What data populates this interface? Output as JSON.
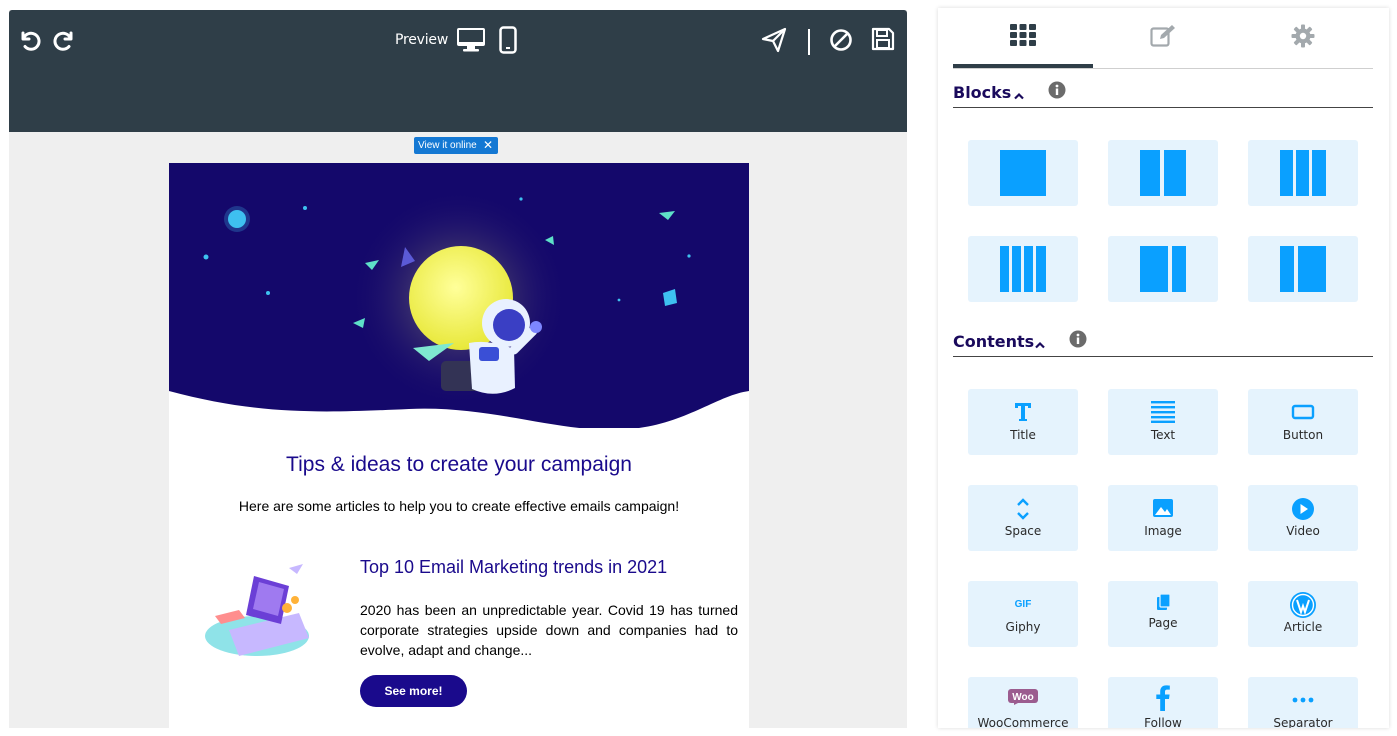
{
  "toolbar": {
    "preview_label": "Preview",
    "icons": [
      "undo-icon",
      "redo-icon",
      "desktop-icon",
      "mobile-icon",
      "send-test-icon",
      "cancel-icon",
      "save-icon"
    ]
  },
  "view_online": {
    "label": "View it online",
    "close": "✕"
  },
  "email": {
    "title": "Tips & ideas to create your campaign",
    "intro": "Here are some articles to help you to create effective emails campaign!",
    "article": {
      "title": "Top 10 Email Marketing trends in 2021",
      "body": "2020 has been an unpredictable year. Covid 19 has turned corporate strategies upside down and companies had to evolve, adapt and change...",
      "button": "See more!"
    },
    "colors": {
      "primary": "#1a0a8c",
      "hero_bg": "#14086b"
    }
  },
  "panel": {
    "tabs": [
      "grid-icon",
      "edit-icon",
      "gear-icon"
    ],
    "blocks": {
      "label": "Blocks"
    },
    "contents": {
      "label": "Contents",
      "items": [
        {
          "label": "Title",
          "icon": "title-icon"
        },
        {
          "label": "Text",
          "icon": "text-icon"
        },
        {
          "label": "Button",
          "icon": "button-icon"
        },
        {
          "label": "Space",
          "icon": "space-icon"
        },
        {
          "label": "Image",
          "icon": "image-icon"
        },
        {
          "label": "Video",
          "icon": "video-icon"
        },
        {
          "label": "Giphy",
          "icon": "giphy-icon"
        },
        {
          "label": "Page",
          "icon": "page-icon"
        },
        {
          "label": "Article",
          "icon": "wordpress-icon"
        },
        {
          "label": "WooCommerce",
          "icon": "woo-icon"
        },
        {
          "label": "Follow",
          "icon": "facebook-icon"
        },
        {
          "label": "Separator",
          "icon": "dots-icon"
        }
      ]
    },
    "accent": "#0aa0ff"
  }
}
